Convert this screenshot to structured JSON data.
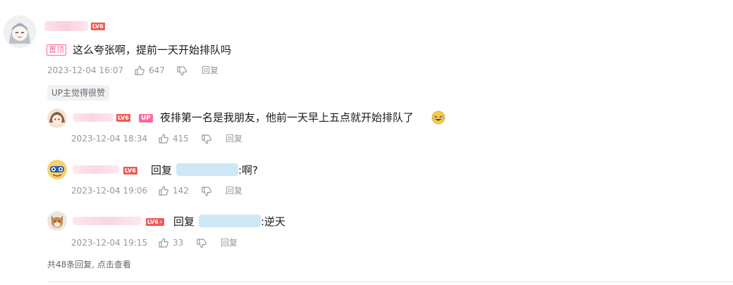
{
  "main_comment": {
    "pin_label": "置顶",
    "text": "这么夸张啊，提前一天开始排队吗",
    "time": "2023-12-04 16:07",
    "likes": "647",
    "reply_label": "回复",
    "up_liked_label": "UP主觉得很赞",
    "level": "LV6"
  },
  "replies": [
    {
      "level": "LV6",
      "up_badge": "UP",
      "text": "夜排第一名是我朋友，他前一天早上五点就开始排队了",
      "time": "2023-12-04 18:34",
      "likes": "415",
      "reply_label": "回复"
    },
    {
      "level": "LV6",
      "reply_prefix": "回复",
      "text_suffix": ":啊?",
      "time": "2023-12-04 19:06",
      "likes": "142",
      "reply_label": "回复"
    },
    {
      "level": "LV6",
      "reply_prefix": "回复",
      "text_suffix": ":逆天",
      "time": "2023-12-04 19:15",
      "likes": "33",
      "reply_label": "回复"
    }
  ],
  "footer": {
    "more_replies": "共48条回复, 点击查看"
  },
  "icons": {
    "like": "thumbs-up-icon",
    "dislike": "thumbs-down-icon",
    "emoji": "laughing-emoji-icon"
  },
  "colors": {
    "level_badge": "#f05a55",
    "pin": "#ff6699",
    "meta": "#9499a0",
    "mention_blur": "#cfe8f5"
  }
}
